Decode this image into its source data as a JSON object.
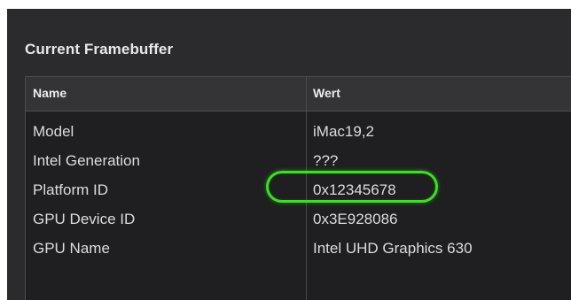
{
  "section": {
    "title": "Current Framebuffer"
  },
  "table": {
    "columns": [
      "Name",
      "Wert"
    ],
    "rows": [
      {
        "name": "Model",
        "value": "iMac19,2"
      },
      {
        "name": "Intel Generation",
        "value": "???"
      },
      {
        "name": "Platform ID",
        "value": "0x12345678"
      },
      {
        "name": "GPU Device ID",
        "value": "0x3E928086"
      },
      {
        "name": "GPU Name",
        "value": "Intel UHD Graphics 630"
      }
    ]
  },
  "colors": {
    "panel_bg": "#2b2b2d",
    "table_bg": "#1f1f21",
    "header_bg": "#343437",
    "highlight": "#37e21f"
  }
}
